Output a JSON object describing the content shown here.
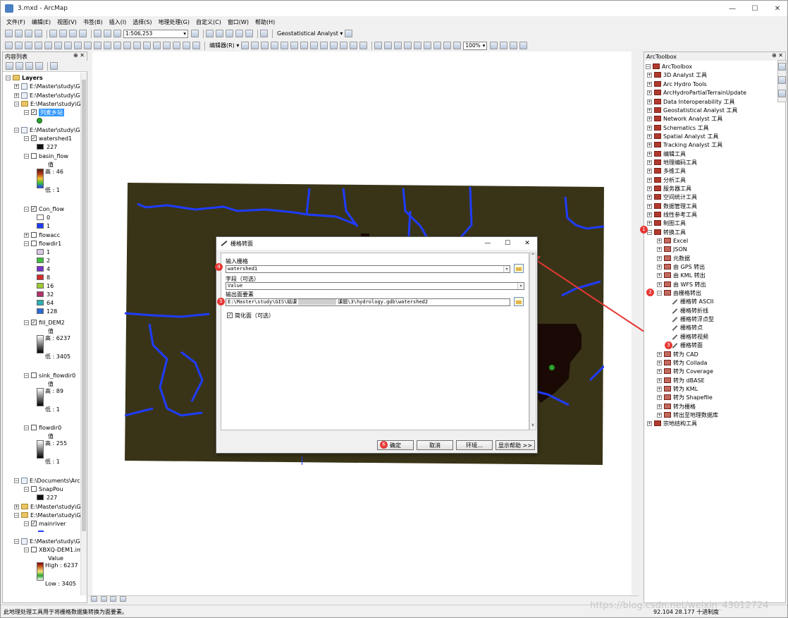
{
  "window": {
    "title": "3.mxd - ArcMap",
    "controls": [
      "—",
      "☐",
      "✕"
    ]
  },
  "menu": [
    "文件(F)",
    "编辑(E)",
    "视图(V)",
    "书签(B)",
    "插入(I)",
    "选择(S)",
    "地理处理(G)",
    "自定义(C)",
    "窗口(W)",
    "帮助(H)"
  ],
  "toolbar": {
    "scale": "1:506,253",
    "geostat_label": "Geostatistical Analyst ▾",
    "editor_label": "编辑器(R) ▾",
    "zoom_pct": "100%"
  },
  "toc": {
    "title": "内容列表",
    "layers_label": "Layers",
    "groups": [
      {
        "path": "E:\\Master\\study\\GI"
      },
      {
        "path": "E:\\Master\\study\\GI"
      },
      {
        "path": "E:\\Master\\study\\GI"
      },
      {
        "layer": "列麦乡站"
      },
      {
        "path": "E:\\Master\\study\\GI"
      },
      {
        "layer": "watershed1",
        "value": "227"
      },
      {
        "layer": "basin_flow",
        "label": "值",
        "high": "高 : 46",
        "low": "低 : 1"
      },
      {
        "layer": "Con_flow",
        "v0": "0",
        "v1": "1"
      },
      {
        "layer": "flowacc"
      },
      {
        "layer": "flowdir1",
        "classes": [
          "1",
          "2",
          "4",
          "8",
          "16",
          "32",
          "64",
          "128"
        ]
      },
      {
        "layer": "fill_DEM2",
        "label": "值",
        "high": "高 : 6237",
        "low": "低 : 3405"
      },
      {
        "layer": "sink_flowdir0",
        "label": "值",
        "high": "高 : 89",
        "low": "低 : 1"
      },
      {
        "layer": "flowdir0",
        "label": "值",
        "high": "高 : 255",
        "low": "低 : 1"
      },
      {
        "path": "E:\\Documents\\ArcG"
      },
      {
        "layer": "SnapPou",
        "value": "227"
      },
      {
        "path": "E:\\Master\\study\\GI"
      },
      {
        "path": "E:\\Master\\study\\GI"
      },
      {
        "layer": "mainriver"
      },
      {
        "path": "E:\\Master\\study\\GI"
      },
      {
        "layer": "XBXQ-DEM1.im",
        "label": "Value",
        "high": "High : 6237",
        "low": "Low : 3405"
      }
    ]
  },
  "arctoolbox": {
    "title": "ArcToolbox",
    "root": "ArcToolbox",
    "toolboxes": [
      "3D Analyst 工具",
      "Arc Hydro Tools",
      "ArcHydroPartialTerrainUpdate",
      "Data Interoperability 工具",
      "Geostatistical Analyst 工具",
      "Network Analyst 工具",
      "Schematics 工具",
      "Spatial Analyst 工具",
      "Tracking Analyst 工具",
      "编辑工具",
      "地理编码工具",
      "多维工具",
      "分析工具",
      "服务器工具",
      "空间统计工具",
      "数据管理工具",
      "线性参考工具",
      "制图工具",
      "转换工具"
    ],
    "conversion_children": [
      "Excel",
      "JSON",
      "元数据",
      "由 GPS 转出",
      "由 KML 转出",
      "由 WFS 转出",
      "由栅格转出"
    ],
    "from_raster_tools": [
      "栅格转 ASCII",
      "栅格转折线",
      "栅格转浮点型",
      "栅格转点",
      "栅格转视频",
      "栅格转面"
    ],
    "more_conversion": [
      "转为 CAD",
      "转为 Collada",
      "转为 Coverage",
      "转为 dBASE",
      "转为 KML",
      "转为 Shapefile",
      "转为栅格",
      "转出至地理数据库"
    ],
    "last_toolbox": "宗地结构工具"
  },
  "dialog": {
    "title": "栅格转面",
    "input_label": "输入栅格",
    "input_value": "watershed1",
    "field_label": "字段（可选）",
    "field_value": "Value",
    "output_label": "输出面要素",
    "output_value_a": "E:\\Master\\study\\GIS\\结课",
    "output_value_b": "课题\\3\\hydrology.gdb\\watershed2",
    "simplify_label": "简化面（可选）",
    "ok": "确定",
    "cancel": "取消",
    "env": "环境...",
    "help": "显示帮助 >>"
  },
  "badges": [
    "1",
    "2",
    "3",
    "4",
    "5",
    "6"
  ],
  "status": {
    "message": "此地理处理工具用于将栅格数据集转换为面要素。",
    "coords": "92.104  28.177 十进制度"
  },
  "watermark": "https://blog.csdn.net/weixin_43012724",
  "colors": {
    "raster_bg": "#393418",
    "river": "#1f3cff",
    "basin": "#1a0904",
    "arrow": "#e53935",
    "select": "#3399ff"
  }
}
